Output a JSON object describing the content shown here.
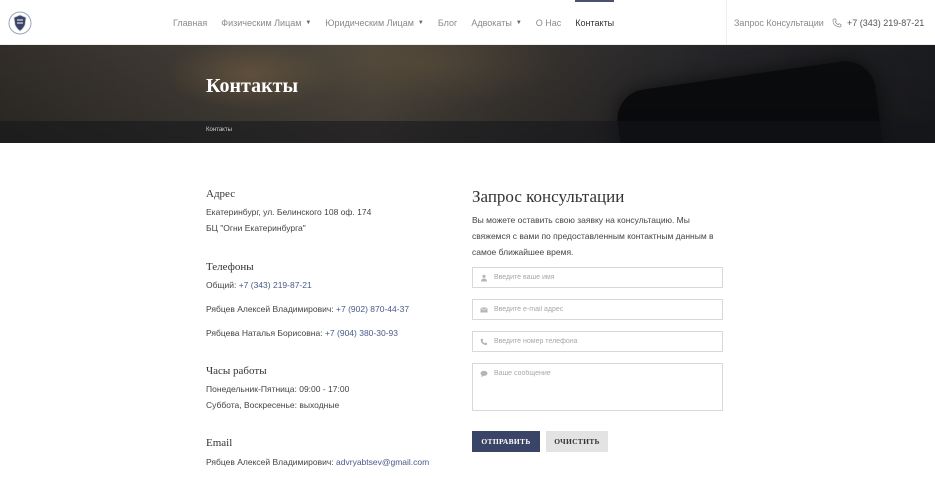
{
  "header": {
    "logo_icon": "shield-crest-icon",
    "nav": [
      {
        "label": "Главная",
        "dropdown": false,
        "active": false
      },
      {
        "label": "Физическим Лицам",
        "dropdown": true,
        "active": false
      },
      {
        "label": "Юридическим Лицам",
        "dropdown": true,
        "active": false
      },
      {
        "label": "Блог",
        "dropdown": false,
        "active": false
      },
      {
        "label": "Адвокаты",
        "dropdown": true,
        "active": false
      },
      {
        "label": "О Нас",
        "dropdown": false,
        "active": false
      },
      {
        "label": "Контакты",
        "dropdown": false,
        "active": true
      }
    ],
    "consult_link": "Запрос Консультации",
    "phone": "+7 (343) 219-87-21",
    "phone_icon": "phone-icon"
  },
  "hero": {
    "title": "Контакты",
    "breadcrumb": "Контакты"
  },
  "contacts": {
    "address": {
      "heading": "Адрес",
      "line1": "Екатеринбург, ул. Белинского 108 оф. 174",
      "line2": "БЦ \"Огни Екатеринбурга\""
    },
    "phones": {
      "heading": "Телефоны",
      "general_label": "Общий: ",
      "general_value": "+7 (343) 219-87-21",
      "person1_label": "Рябцев Алексей Владимирович: ",
      "person1_value": "+7 (902) 870-44-37",
      "person2_label": "Рябцева Наталья Борисовна: ",
      "person2_value": "+7 (904) 380-30-93"
    },
    "hours": {
      "heading": "Часы работы",
      "line1": "Понедельник-Пятница: 09:00 - 17:00",
      "line2": "Суббота, Воскресенье: выходные"
    },
    "email": {
      "heading": "Email",
      "label": "Рябцев Алексей Владимирович: ",
      "value": "advryabtsev@gmail.com"
    }
  },
  "form": {
    "title": "Запрос консультации",
    "description": "Вы можете оставить свою заявку на консультацию. Мы свяжемся с вами по предоставленным контактным данным в самое ближайшее время.",
    "name_placeholder": "Введите ваше имя",
    "email_placeholder": "Введите e-mail адрес",
    "phone_placeholder": "Введите номер телефона",
    "message_placeholder": "Ваше сообщение",
    "submit_label": "ОТПРАВИТЬ",
    "clear_label": "ОЧИСТИТЬ"
  },
  "colors": {
    "accent": "#3a4466",
    "link": "#4a5a8a"
  }
}
